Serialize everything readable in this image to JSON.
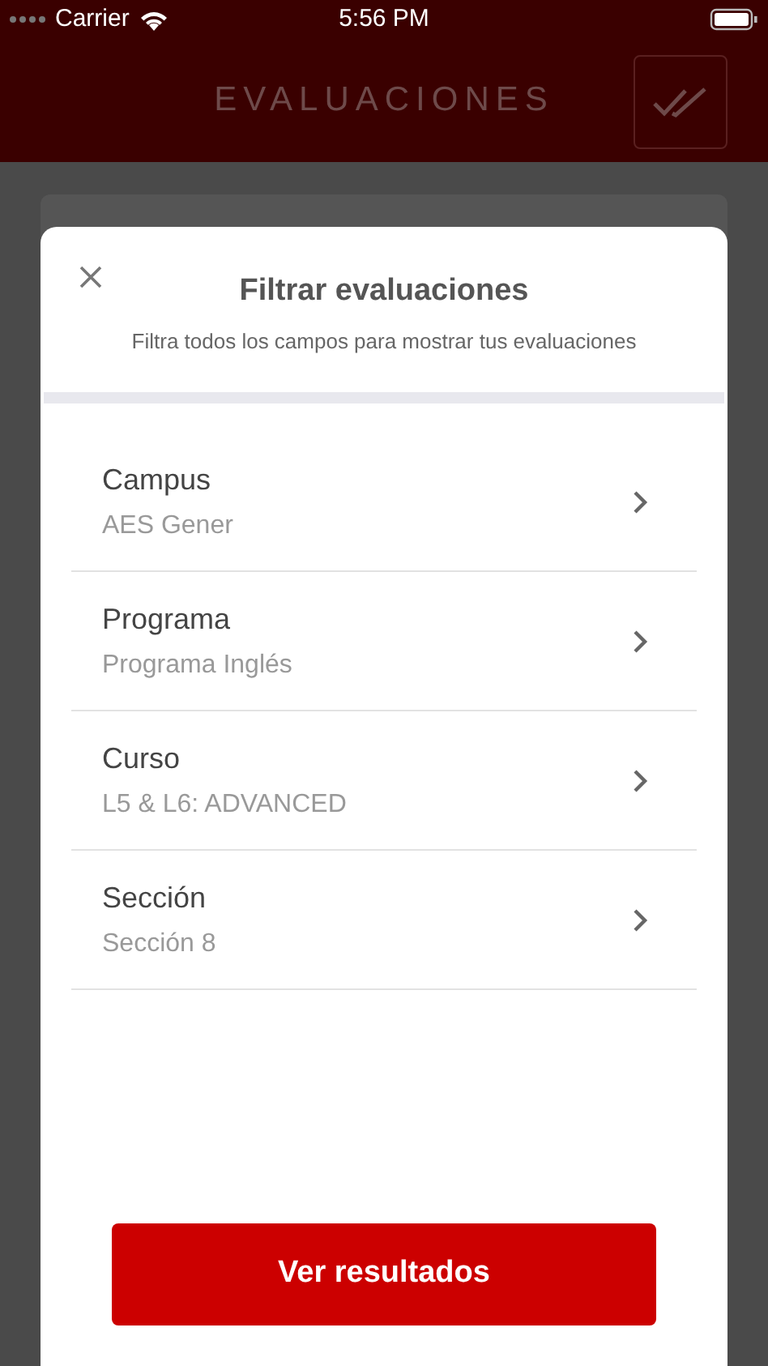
{
  "status_bar": {
    "carrier": "Carrier",
    "time": "5:56 PM"
  },
  "header": {
    "title": "EVALUACIONES"
  },
  "modal": {
    "title": "Filtrar evaluaciones",
    "subtitle": "Filtra todos los campos para mostrar tus evaluaciones",
    "filters": [
      {
        "label": "Campus",
        "value": "AES Gener"
      },
      {
        "label": "Programa",
        "value": "Programa Inglés"
      },
      {
        "label": "Curso",
        "value": "L5 & L6: ADVANCED"
      },
      {
        "label": "Sección",
        "value": "Sección 8"
      }
    ],
    "button": "Ver resultados"
  }
}
